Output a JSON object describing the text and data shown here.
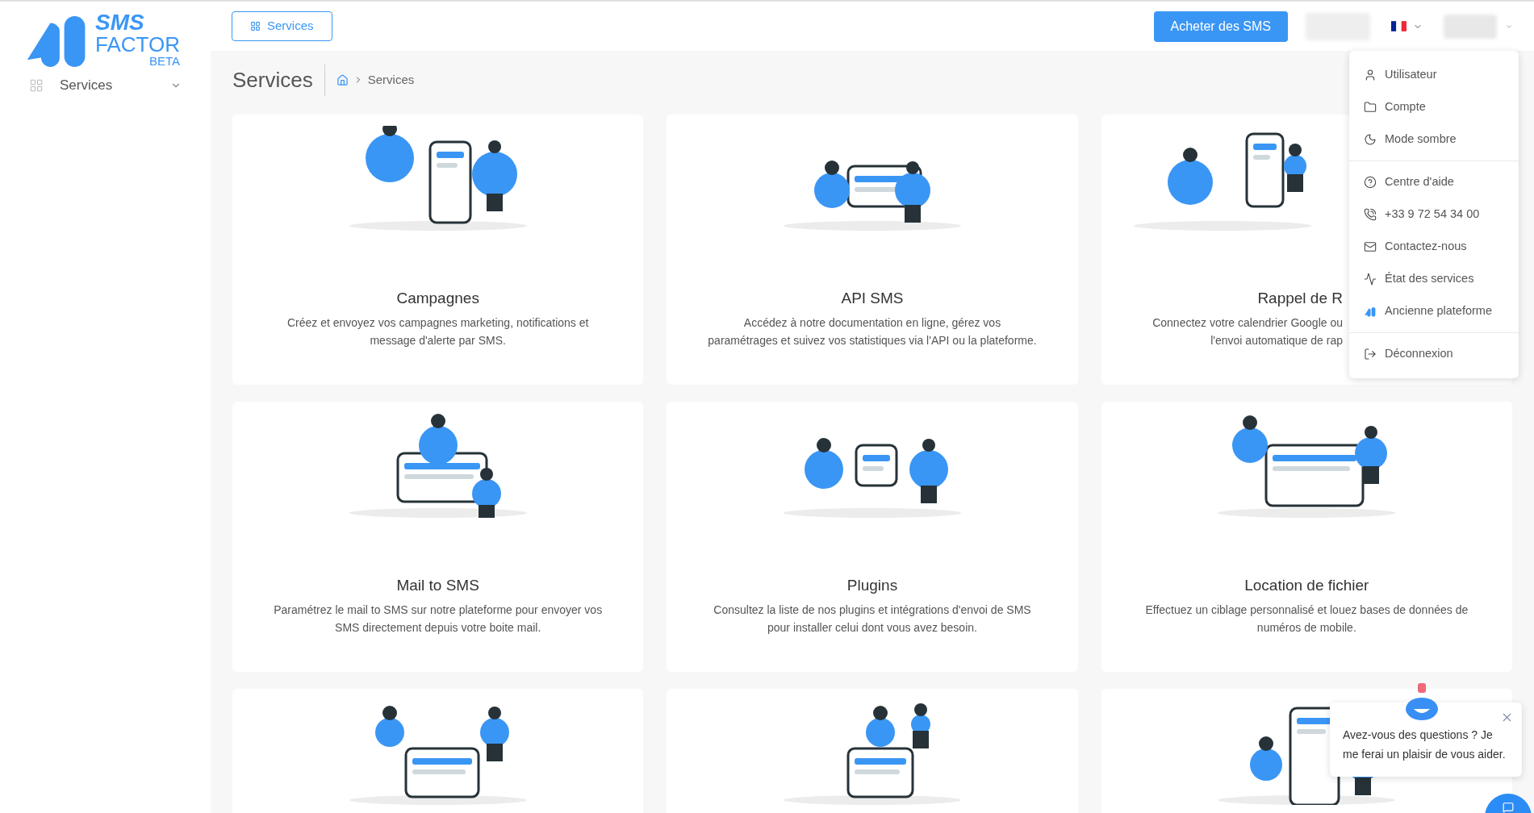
{
  "logo": {
    "line_1": "SMS",
    "line_2": "FACTOR",
    "badge": "BETA"
  },
  "sidebar": {
    "items": [
      {
        "label": "Services",
        "expanded": false
      }
    ]
  },
  "header": {
    "services_button": "Services",
    "buy_button": "Acheter des SMS"
  },
  "page": {
    "title": "Services",
    "breadcrumb": [
      "Services"
    ]
  },
  "cards": [
    {
      "kind": "campaigns",
      "title": "Campagnes",
      "description": [
        "Créez et envoyez vos campagnes marketing, notifications et",
        "message d'alerte par SMS."
      ]
    },
    {
      "kind": "api",
      "title": "API SMS",
      "description": [
        "Accédez à notre documentation en ligne, gérez vos",
        "paramétrages et suivez vos statistiques via l'API ou la plateforme."
      ]
    },
    {
      "kind": "reminder",
      "title": "Rappel de R",
      "description": [
        "Connectez votre calendrier Google ou",
        "l'envoi automatique de rap"
      ]
    },
    {
      "kind": "mail",
      "title": "Mail to SMS",
      "description": [
        "Paramétrez le mail to SMS sur notre plateforme pour envoyer vos",
        "SMS directement depuis votre boite mail."
      ]
    },
    {
      "kind": "plugins",
      "title": "Plugins",
      "description": [
        "Consultez la liste de nos plugins et intégrations d'envoi de SMS",
        "pour installer celui dont vous avez besoin."
      ]
    },
    {
      "kind": "targeting",
      "title": "Location de fichier",
      "description": [
        "Effectuez un ciblage personnalisé et louez bases de données de",
        "numéros de mobile."
      ]
    },
    {
      "kind": "party"
    },
    {
      "kind": "support"
    },
    {
      "kind": "server"
    }
  ],
  "user_menu": {
    "groups": [
      [
        {
          "kind": "user",
          "label": "Utilisateur"
        },
        {
          "kind": "folder",
          "label": "Compte"
        },
        {
          "kind": "moon",
          "label": "Mode sombre"
        }
      ],
      [
        {
          "kind": "help",
          "label": "Centre d'aide"
        },
        {
          "kind": "phone",
          "label": "+33 9 72 54 34 00"
        },
        {
          "kind": "mail",
          "label": "Contactez-nous"
        },
        {
          "kind": "activity",
          "label": "État des services"
        },
        {
          "kind": "logo",
          "label": "Ancienne plateforme"
        }
      ],
      [
        {
          "kind": "logout",
          "label": "Déconnexion"
        }
      ]
    ]
  },
  "chat": {
    "message": "Avez-vous des questions ? Je me ferai un plaisir de vous aider."
  }
}
